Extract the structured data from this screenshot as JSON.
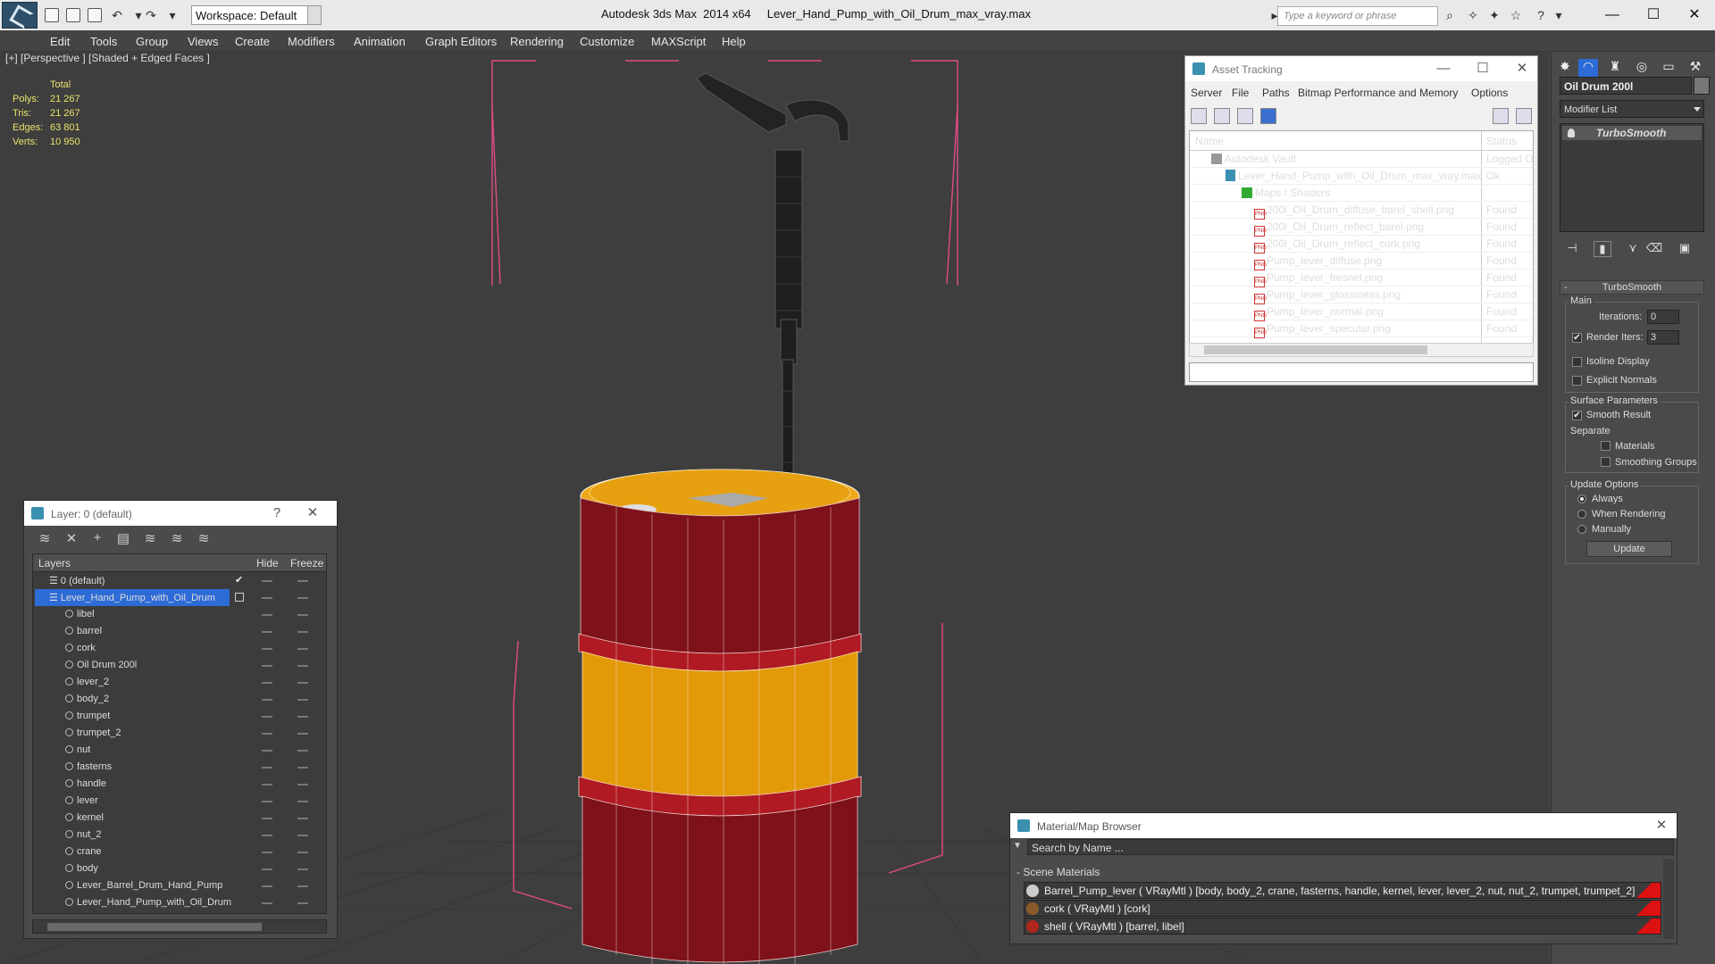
{
  "titlebar": {
    "workspace": "Workspace: Default",
    "app_title": "Autodesk 3ds Max  2014 x64     Lever_Hand_Pump_with_Oil_Drum_max_vray.max",
    "search_placeholder": "Type a keyword or phrase",
    "minimize": "—",
    "maximize": "☐",
    "close": "✕"
  },
  "menu": [
    "Edit",
    "Tools",
    "Group",
    "Views",
    "Create",
    "Modifiers",
    "Animation",
    "Graph Editors",
    "Rendering",
    "Customize",
    "MAXScript",
    "Help"
  ],
  "viewport": {
    "label": "[+] [Perspective ] [Shaded + Edged Faces ]",
    "stats_header": "Total",
    "stats": [
      {
        "k": "Polys:",
        "v": "21 267"
      },
      {
        "k": "Tris:",
        "v": "21 267"
      },
      {
        "k": "Edges:",
        "v": "63 801"
      },
      {
        "k": "Verts:",
        "v": "10 950"
      }
    ]
  },
  "asset_tracking": {
    "title": "Asset Tracking",
    "menu": [
      "Server",
      "File",
      "Paths",
      "Bitmap Performance and Memory",
      "Options"
    ],
    "col_name": "Name",
    "col_status": "Status",
    "rows": [
      {
        "name": "Autodesk Vault",
        "status": "Logged O",
        "icon": "vault-icon",
        "indent": 1
      },
      {
        "name": "Lever_Hand_Pump_with_Oil_Drum_max_vray.max",
        "status": "Ok",
        "icon": "max-file-icon",
        "indent": 2
      },
      {
        "name": "Maps / Shaders",
        "status": "",
        "icon": "folder-icon",
        "indent": 3
      },
      {
        "name": "200l_Oil_Drum_diffuse_barel_shell.png",
        "status": "Found",
        "icon": "png-icon",
        "indent": 4
      },
      {
        "name": "200l_Oil_Drum_reflect_barel.png",
        "status": "Found",
        "icon": "png-icon",
        "indent": 4
      },
      {
        "name": "200l_Oil_Drum_reflect_cork.png",
        "status": "Found",
        "icon": "png-icon",
        "indent": 4
      },
      {
        "name": "Pump_lever_diffuse.png",
        "status": "Found",
        "icon": "png-icon",
        "indent": 4
      },
      {
        "name": "Pump_lever_fresnel.png",
        "status": "Found",
        "icon": "png-icon",
        "indent": 4
      },
      {
        "name": "Pump_lever_glossiness.png",
        "status": "Found",
        "icon": "png-icon",
        "indent": 4
      },
      {
        "name": "Pump_lever_normal.png",
        "status": "Found",
        "icon": "png-icon",
        "indent": 4
      },
      {
        "name": "Pump_lever_specular.png",
        "status": "Found",
        "icon": "png-icon",
        "indent": 4
      }
    ]
  },
  "layer_window": {
    "title": "Layer: 0 (default)",
    "help": "?",
    "col_layers": "Layers",
    "col_hide": "Hide",
    "col_freeze": "Freeze",
    "rows": [
      {
        "name": "0 (default)",
        "type": "layer",
        "checked": true
      },
      {
        "name": "Lever_Hand_Pump_with_Oil_Drum",
        "type": "layer",
        "selected": true
      },
      {
        "name": "libel",
        "type": "object"
      },
      {
        "name": "barrel",
        "type": "object"
      },
      {
        "name": "cork",
        "type": "object"
      },
      {
        "name": "Oil Drum 200l",
        "type": "object"
      },
      {
        "name": "lever_2",
        "type": "object"
      },
      {
        "name": "body_2",
        "type": "object"
      },
      {
        "name": "trumpet",
        "type": "object"
      },
      {
        "name": "trumpet_2",
        "type": "object"
      },
      {
        "name": "nut",
        "type": "object"
      },
      {
        "name": "fasterns",
        "type": "object"
      },
      {
        "name": "handle",
        "type": "object"
      },
      {
        "name": "lever",
        "type": "object"
      },
      {
        "name": "kernel",
        "type": "object"
      },
      {
        "name": "nut_2",
        "type": "object"
      },
      {
        "name": "crane",
        "type": "object"
      },
      {
        "name": "body",
        "type": "object"
      },
      {
        "name": "Lever_Barrel_Drum_Hand_Pump",
        "type": "object"
      },
      {
        "name": "Lever_Hand_Pump_with_Oil_Drum",
        "type": "object"
      }
    ]
  },
  "command_panel": {
    "object_name": "Oil Drum 200l",
    "modifier_list": "Modifier List",
    "modifier": "TurboSmooth",
    "rollout": "TurboSmooth",
    "main_label": "Main",
    "iterations_label": "Iterations:",
    "iterations": "0",
    "render_iters_label": "Render Iters:",
    "render_iters": "3",
    "isoline": "Isoline Display",
    "explicit_normals": "Explicit Normals",
    "surface_params": "Surface Parameters",
    "smooth_result": "Smooth Result",
    "separate": "Separate",
    "materials": "Materials",
    "smoothing_groups": "Smoothing Groups",
    "update_options": "Update Options",
    "always": "Always",
    "when_rendering": "When Rendering",
    "manually": "Manually",
    "update_button": "Update",
    "collapse_sign": "-"
  },
  "material_browser": {
    "title": "Material/Map Browser",
    "search_placeholder": "Search by Name ...",
    "section": "- Scene Materials",
    "rows": [
      {
        "text": "Barrel_Pump_lever  ( VRayMtl ) [body, body_2, crane, fasterns, handle, kernel, lever, lever_2, nut, nut_2, trumpet, trumpet_2]"
      },
      {
        "text": "cork  ( VRayMtl ) [cork]"
      },
      {
        "text": "shell  ( VRayMtl ) [barrel, libel]"
      }
    ]
  },
  "colors": {
    "drum_red": "#7e1119",
    "drum_yellow": "#e39a08",
    "viewport_bg": "#3e3e3e",
    "selection_blue": "#2d6bd6",
    "stats_yellow": "#e9e36a"
  }
}
